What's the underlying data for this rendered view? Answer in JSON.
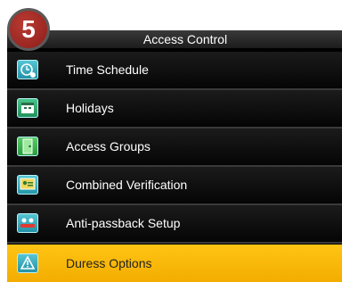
{
  "step_number": "5",
  "title": "Access Control",
  "menu_items": [
    {
      "label": "Time Schedule",
      "icon": "clock-icon"
    },
    {
      "label": "Holidays",
      "icon": "calendar-icon"
    },
    {
      "label": "Access Groups",
      "icon": "door-icon"
    },
    {
      "label": "Combined Verification",
      "icon": "verify-icon"
    },
    {
      "label": "Anti-passback Setup",
      "icon": "anti-passback-icon"
    },
    {
      "label": "Duress Options",
      "icon": "duress-icon"
    }
  ],
  "selected_index": 5,
  "colors": {
    "selected_bg": "#f8b800",
    "menu_bg": "#000000",
    "badge": "#a12a24",
    "icon": "#3fb4c6"
  }
}
